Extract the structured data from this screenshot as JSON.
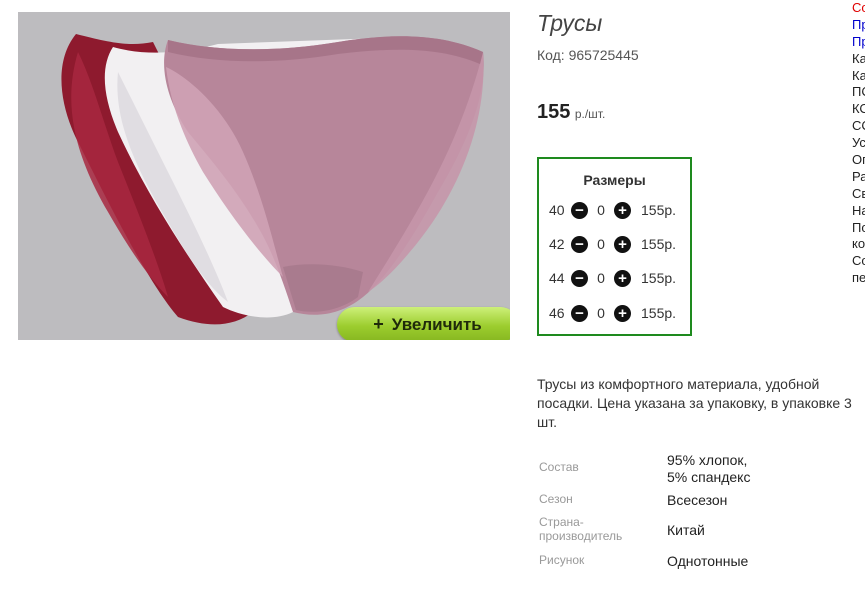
{
  "product": {
    "title": "Трусы",
    "code": "Код: 965725445",
    "price_value": "155",
    "price_unit": "р./шт.",
    "zoom_button": {
      "plus": "+",
      "label": "Увеличить"
    },
    "sizes_title": "Размеры",
    "sizes": [
      {
        "size": "40",
        "qty": "0",
        "price": "155р."
      },
      {
        "size": "42",
        "qty": "0",
        "price": "155р."
      },
      {
        "size": "44",
        "qty": "0",
        "price": "155р."
      },
      {
        "size": "46",
        "qty": "0",
        "price": "155р."
      }
    ],
    "description": "Трусы из комфортного материала, удобной посадки. Цена указана за упаковку, в упаковке 3 шт.",
    "properties": [
      {
        "key": "Состав",
        "value": "95% хлопок,\n5% спандекс"
      },
      {
        "key": "Сезон",
        "value": "Всесезон"
      },
      {
        "key": "Страна-\nпроизводитель",
        "value": "Китай"
      },
      {
        "key": "Рисунок",
        "value": "Однотонные"
      }
    ]
  },
  "sidebar": {
    "items": [
      {
        "text": "Со",
        "color": "#e00000"
      },
      {
        "text": "Пр",
        "color": "#0000cc"
      },
      {
        "text": "Пр",
        "color": "#0000cc"
      },
      {
        "text": "Ка",
        "color": "#222222"
      },
      {
        "text": "Ка",
        "color": "#222222"
      },
      {
        "text": "ПС",
        "color": "#222222"
      },
      {
        "text": "КС",
        "color": "#222222"
      },
      {
        "text": "СС",
        "color": "#222222"
      },
      {
        "text": "Ус",
        "color": "#222222"
      },
      {
        "text": "Оп",
        "color": "#222222"
      },
      {
        "text": "Ра",
        "color": "#222222"
      },
      {
        "text": "Св",
        "color": "#222222"
      },
      {
        "text": "На",
        "color": "#222222"
      },
      {
        "text": "По",
        "color": "#222222"
      },
      {
        "text": "ко",
        "color": "#222222"
      },
      {
        "text": "Со",
        "color": "#222222"
      },
      {
        "text": "пе",
        "color": "#222222"
      }
    ]
  },
  "colors": {
    "sizes_border": "#1e8a1e",
    "zoom_button": "#9ccd2e",
    "photo_bg": "#bdbcbf"
  }
}
